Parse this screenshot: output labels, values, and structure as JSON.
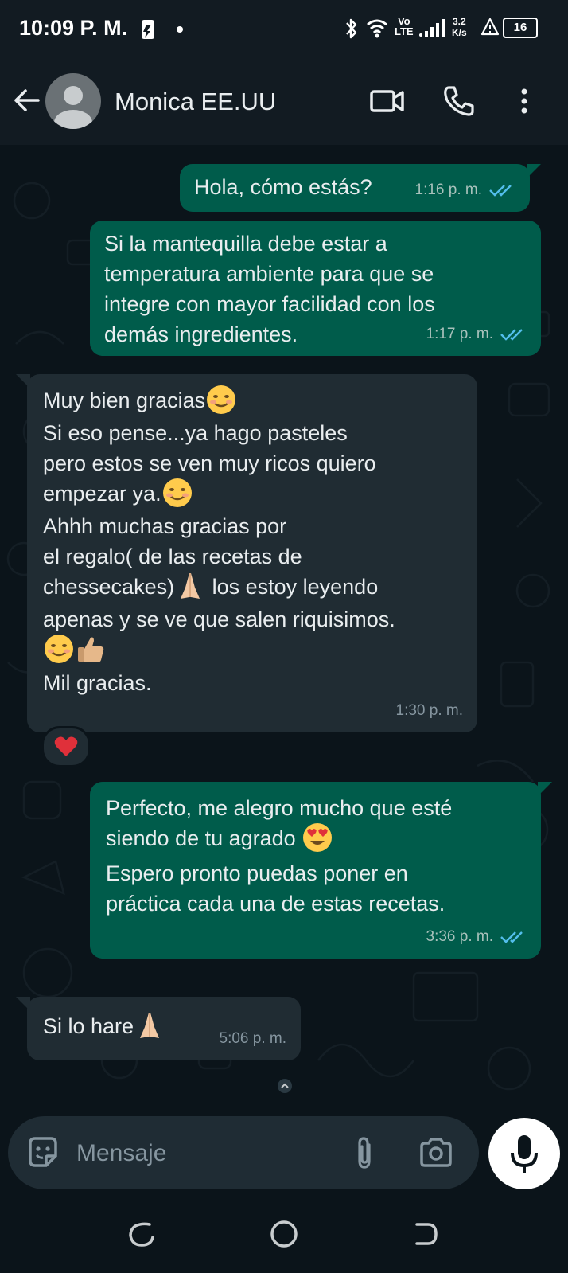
{
  "status_bar": {
    "time": "10:09 P. M.",
    "network_label_top": "Vo",
    "network_label_bottom": "LTE",
    "speed_value": "3.2",
    "speed_unit": "K/s",
    "battery": "16"
  },
  "header": {
    "contact_name": "Monica EE.UU"
  },
  "messages": [
    {
      "direction": "out",
      "text": "Hola, cómo estás?",
      "time": "1:16 p. m."
    },
    {
      "direction": "out",
      "text": "Si la mantequilla debe estar a temperatura ambiente para que se integre con mayor facilidad con los demás ingredientes.",
      "time": "1:17 p. m."
    },
    {
      "direction": "in",
      "lines": [
        "Muy bien gracias",
        "Si eso pense...ya hago pasteles",
        "pero estos se ven muy ricos quiero",
        "empezar ya.",
        "Ahhh muchas gracias por",
        "el regalo( de las recetas de",
        "chessecakes)",
        " los estoy leyendo",
        "apenas y se ve que salen riquisimos.",
        "Mil gracias."
      ],
      "time": "1:30 p. m.",
      "reaction": "red-heart"
    },
    {
      "direction": "out",
      "lines": [
        "Perfecto, me alegro mucho que esté",
        "siendo de tu agrado",
        "Espero pronto puedas poner en",
        "práctica cada una de estas recetas."
      ],
      "time": "3:36 p. m."
    },
    {
      "direction": "in",
      "text": "Si lo hare",
      "time": "5:06 p. m."
    }
  ],
  "composer": {
    "placeholder": "Mensaje"
  },
  "colors": {
    "outgoing_bubble": "#005c4b",
    "incoming_bubble": "#202c33",
    "read_ticks": "#53bdeb",
    "background": "#0b141a"
  },
  "icons": [
    "back-arrow-icon",
    "video-call-icon",
    "phone-icon",
    "more-vert-icon",
    "sticker-icon",
    "attach-icon",
    "camera-icon",
    "mic-icon"
  ]
}
